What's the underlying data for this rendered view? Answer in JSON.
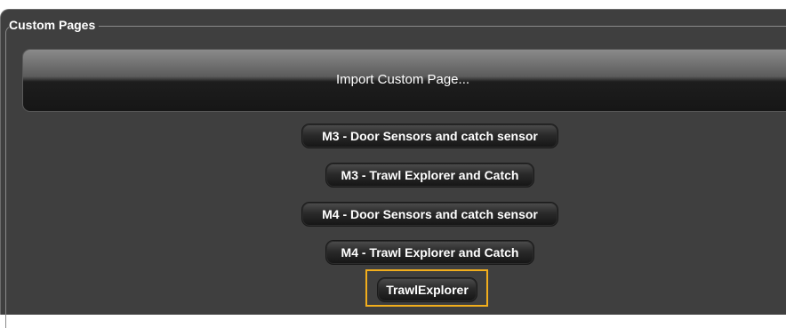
{
  "group": {
    "title": "Custom Pages"
  },
  "import_button": {
    "label": "Import Custom Page..."
  },
  "pages": [
    {
      "label": "M3 - Door Sensors and catch sensor"
    },
    {
      "label": "M3 - Trawl Explorer and Catch"
    },
    {
      "label": "M4 - Door Sensors and catch sensor"
    },
    {
      "label": "M4 - Trawl Explorer and Catch"
    },
    {
      "label": "TrawlExplorer",
      "selected": true
    }
  ],
  "colors": {
    "panel_background": "#3f3f3f",
    "selection_highlight": "#f2ae1c",
    "text": "#ffffff"
  }
}
